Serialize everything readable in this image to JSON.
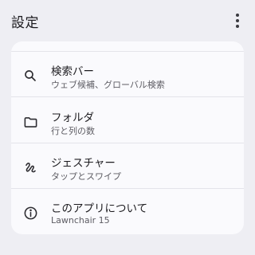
{
  "appbar": {
    "title": "設定",
    "menu_icon": "more-vert-icon"
  },
  "settings": [
    {
      "icon": "search-icon",
      "label": "検索バー",
      "sub": "ウェブ候補、グローバル検索"
    },
    {
      "icon": "folder-icon",
      "label": "フォルダ",
      "sub": "行と列の数"
    },
    {
      "icon": "gesture-icon",
      "label": "ジェスチャー",
      "sub": "タップとスワイプ"
    },
    {
      "icon": "info-icon",
      "label": "このアプリについて",
      "sub": "Lawnchair 15"
    }
  ]
}
